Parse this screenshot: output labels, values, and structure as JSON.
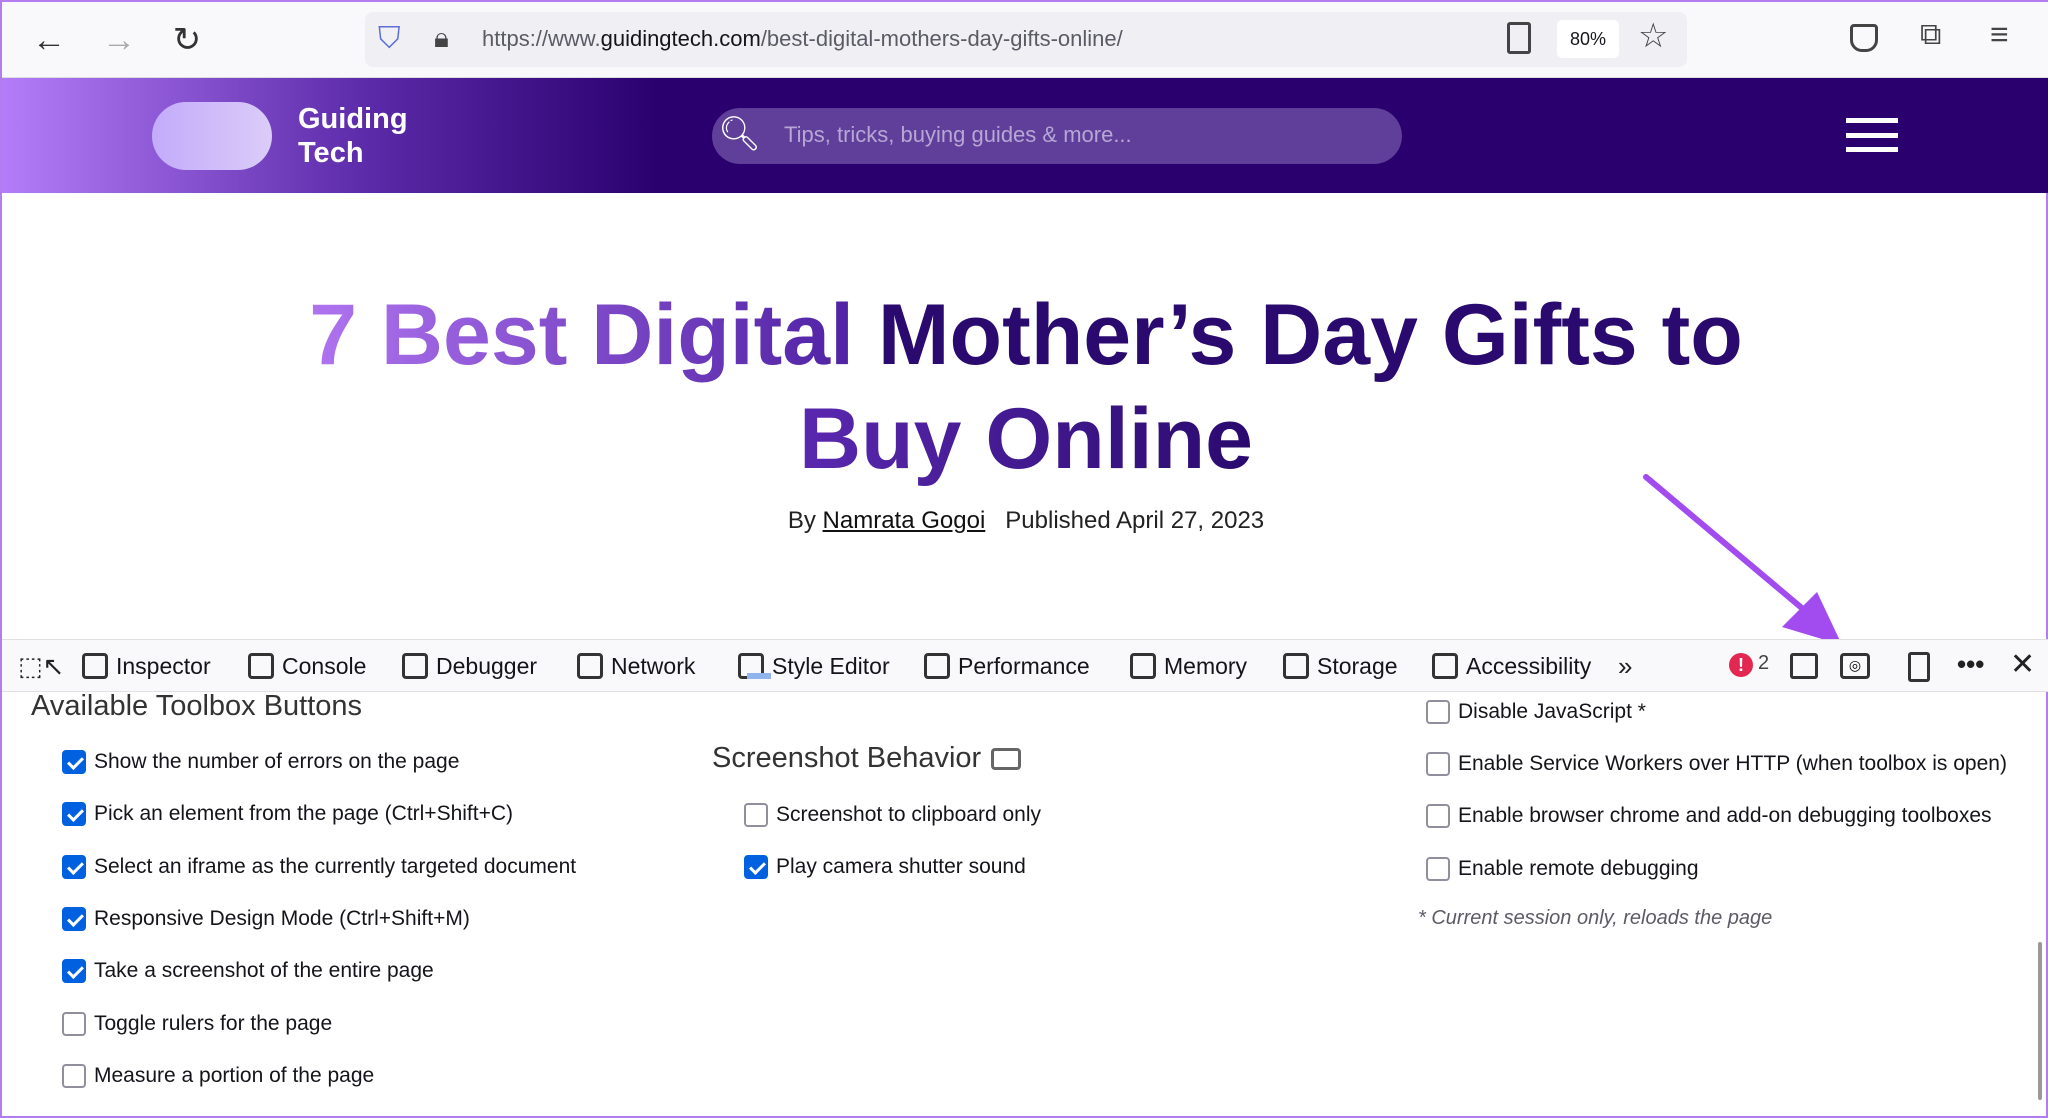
{
  "browser": {
    "url_host": "https://www.",
    "url_domain": "guidingtech.com",
    "url_path": "/best-digital-mothers-day-gifts-online/",
    "zoom": "80%"
  },
  "site": {
    "logo_line1": "Guiding",
    "logo_line2": "Tech",
    "search_placeholder": "Tips, tricks, buying guides & more..."
  },
  "article": {
    "title_line1_a": "7 Best Digital ",
    "title_line1_b": "Mother’s Day Gifts to",
    "title_line2": "Buy Online",
    "by": "By",
    "author": "Namrata Gogoi",
    "published": "Published April 27, 2023"
  },
  "devtools": {
    "tabs": [
      {
        "label": "Inspector",
        "icon": "inspector-icon"
      },
      {
        "label": "Console",
        "icon": "console-icon"
      },
      {
        "label": "Debugger",
        "icon": "debugger-icon"
      },
      {
        "label": "Network",
        "icon": "network-icon"
      },
      {
        "label": "Style Editor",
        "icon": "style-editor-icon"
      },
      {
        "label": "Performance",
        "icon": "performance-icon"
      },
      {
        "label": "Memory",
        "icon": "memory-icon"
      },
      {
        "label": "Storage",
        "icon": "storage-icon"
      },
      {
        "label": "Accessibility",
        "icon": "accessibility-icon"
      }
    ],
    "error_count": "2"
  },
  "settings": {
    "toolbox_heading": "Available Toolbox Buttons",
    "toolbox": [
      {
        "label": "Show the number of errors on the page",
        "checked": true
      },
      {
        "label": "Pick an element from the page (Ctrl+Shift+C)",
        "checked": true
      },
      {
        "label": "Select an iframe as the currently targeted document",
        "checked": true
      },
      {
        "label": "Responsive Design Mode (Ctrl+Shift+M)",
        "checked": true
      },
      {
        "label": "Take a screenshot of the entire page",
        "checked": true
      },
      {
        "label": "Toggle rulers for the page",
        "checked": false
      },
      {
        "label": "Measure a portion of the page",
        "checked": false
      }
    ],
    "screenshot_heading": "Screenshot Behavior",
    "screenshot": [
      {
        "label": "Screenshot to clipboard only",
        "checked": false
      },
      {
        "label": "Play camera shutter sound",
        "checked": true
      }
    ],
    "advanced": [
      {
        "label": "Disable JavaScript *",
        "checked": false
      },
      {
        "label": "Enable Service Workers over HTTP (when toolbox is open)",
        "checked": false
      },
      {
        "label": "Enable browser chrome and add-on debugging toolboxes",
        "checked": false
      },
      {
        "label": "Enable remote debugging",
        "checked": false
      }
    ],
    "advanced_note": "* Current session only, reloads the page"
  },
  "colors": {
    "accent": "#0061e0",
    "header": "#2a006e",
    "arrow": "#a24cf0"
  }
}
